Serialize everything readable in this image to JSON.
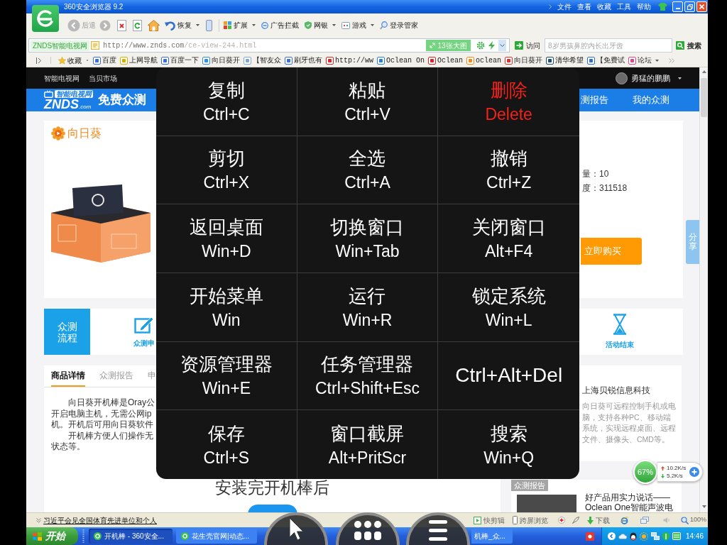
{
  "browser": {
    "title": "360安全浏览器 9.2",
    "menu": [
      "文件",
      "查看",
      "收藏",
      "工具",
      "帮助"
    ]
  },
  "toolbar": {
    "back": {
      "label": "后退",
      "disabled": true
    },
    "forward": {
      "disabled": true
    },
    "restore": {
      "label": "恢复"
    },
    "tools": [
      {
        "label": "扩展",
        "dropdown": true
      },
      {
        "label": "广告拦截",
        "dropdown": false
      },
      {
        "label": "网银",
        "dropdown": true
      },
      {
        "label": "游戏",
        "dropdown": true
      },
      {
        "label": "登录管家",
        "dropdown": false
      }
    ]
  },
  "address": {
    "site_badge": "ZNDS智能电视网",
    "url_host": "http://www.znds.com",
    "url_path": "/ce-view-244.html",
    "image_button": "13张大图",
    "go_button": "访问",
    "search_placeholder": "8岁男孩鼻腔内长出牙齿",
    "search_button": "搜索"
  },
  "bookmarks": {
    "favorites": "收藏",
    "items": [
      {
        "label": "百度",
        "dropdown": false
      },
      {
        "label": "上网导航",
        "dropdown": false
      },
      {
        "label": "百度一下",
        "dropdown": false
      },
      {
        "label": "向日葵开",
        "dropdown": false
      },
      {
        "label": "【智友众",
        "dropdown": false
      },
      {
        "label": "刷牙也有",
        "dropdown": false
      },
      {
        "label": "http://ww",
        "dropdown": false
      },
      {
        "label": "Oclean On",
        "dropdown": false
      },
      {
        "label": "Oclean",
        "dropdown": false
      },
      {
        "label": "oclean",
        "dropdown": false
      },
      {
        "label": "向日葵开",
        "dropdown": false
      },
      {
        "label": "清华希望",
        "dropdown": false
      },
      {
        "label": "【免费试",
        "dropdown": false
      },
      {
        "label": "论坛",
        "dropdown": true
      }
    ]
  },
  "page": {
    "top_links": [
      "智能电视网",
      "当贝市场"
    ],
    "user_name": "勇猛的鹏鹏",
    "logo": {
      "badge": "智能电视网",
      "name": "ZNDS",
      "domain": ".com",
      "title": "免费众测"
    },
    "nav": [
      "测报告",
      "我的众测"
    ],
    "product": {
      "brand": "向日葵",
      "stats": [
        "量：10",
        "度：311518"
      ],
      "buy_button": "立即购买"
    },
    "share_tab": "分享",
    "process": {
      "title": "众测流程",
      "steps": [
        "众测申",
        "活动结束"
      ]
    },
    "details": {
      "tabs": [
        {
          "label": "商品详情",
          "selected": true
        },
        {
          "label": "众测报告",
          "selected": false
        },
        {
          "label": "申",
          "selected": false
        }
      ],
      "paragraphs": [
        [
          "向日葵开机棒是Oray公",
          "开启电脑主机，无需公网ip",
          "机。开机后可用向日葵软件"
        ],
        [
          "开机棒方便人们操作无",
          "状态等。"
        ]
      ],
      "heading": "安装完开机棒后"
    },
    "company": {
      "name": "上海贝锐信息科技",
      "description": [
        "向日葵可远程控制手机或电",
        "脑，支持各种PC、移动端",
        "系统，实现远程桌面、远程",
        "文件、摄像头、CMD等。"
      ]
    },
    "reports": {
      "label": "众测报告",
      "title": [
        "好产品用实力说话——",
        "Oclean One智能声波电"
      ]
    }
  },
  "network_widget": {
    "usage": "67%",
    "upload": "10.2K/s",
    "download": "5.2K/s"
  },
  "shortcuts": [
    {
      "label": "复制",
      "keys": "Ctrl+C",
      "kind": "normal"
    },
    {
      "label": "粘贴",
      "keys": "Ctrl+V",
      "kind": "normal"
    },
    {
      "label": "删除",
      "keys": "Delete",
      "kind": "danger"
    },
    {
      "label": "剪切",
      "keys": "Ctrl+X",
      "kind": "normal"
    },
    {
      "label": "全选",
      "keys": "Ctrl+A",
      "kind": "normal"
    },
    {
      "label": "撤销",
      "keys": "Ctrl+Z",
      "kind": "normal"
    },
    {
      "label": "返回桌面",
      "keys": "Win+D",
      "kind": "normal"
    },
    {
      "label": "切换窗口",
      "keys": "Win+Tab",
      "kind": "normal"
    },
    {
      "label": "关闭窗口",
      "keys": "Alt+F4",
      "kind": "normal"
    },
    {
      "label": "开始菜单",
      "keys": "Win",
      "kind": "normal"
    },
    {
      "label": "运行",
      "keys": "Win+R",
      "kind": "normal"
    },
    {
      "label": "锁定系统",
      "keys": "Win+L",
      "kind": "normal"
    },
    {
      "label": "资源管理器",
      "keys": "Win+E",
      "kind": "normal"
    },
    {
      "label": "任务管理器",
      "keys": "Ctrl+Shift+Esc",
      "kind": "normal"
    },
    {
      "keys": "Ctrl+Alt+Del",
      "kind": "keys_only"
    },
    {
      "label": "保存",
      "keys": "Ctrl+S",
      "kind": "normal"
    },
    {
      "label": "窗口截屏",
      "keys": "Alt+PritScr",
      "kind": "normal"
    },
    {
      "label": "搜索",
      "keys": "Win+Q",
      "kind": "normal"
    }
  ],
  "status_bar": {
    "news": "习近平会见全国体育先进单位和个人",
    "tools": [
      "快剪辑",
      "跨屏浏览"
    ],
    "download": "下载",
    "zoom": "100%"
  },
  "taskbar": {
    "start": "开始",
    "tasks": [
      {
        "label": "开机棒 - 360安全...",
        "selected": true
      },
      {
        "label": "花生壳官网|动态...",
        "selected": false
      },
      {
        "label": "机棒_众...",
        "selected": false
      }
    ],
    "clock": "14:46"
  }
}
